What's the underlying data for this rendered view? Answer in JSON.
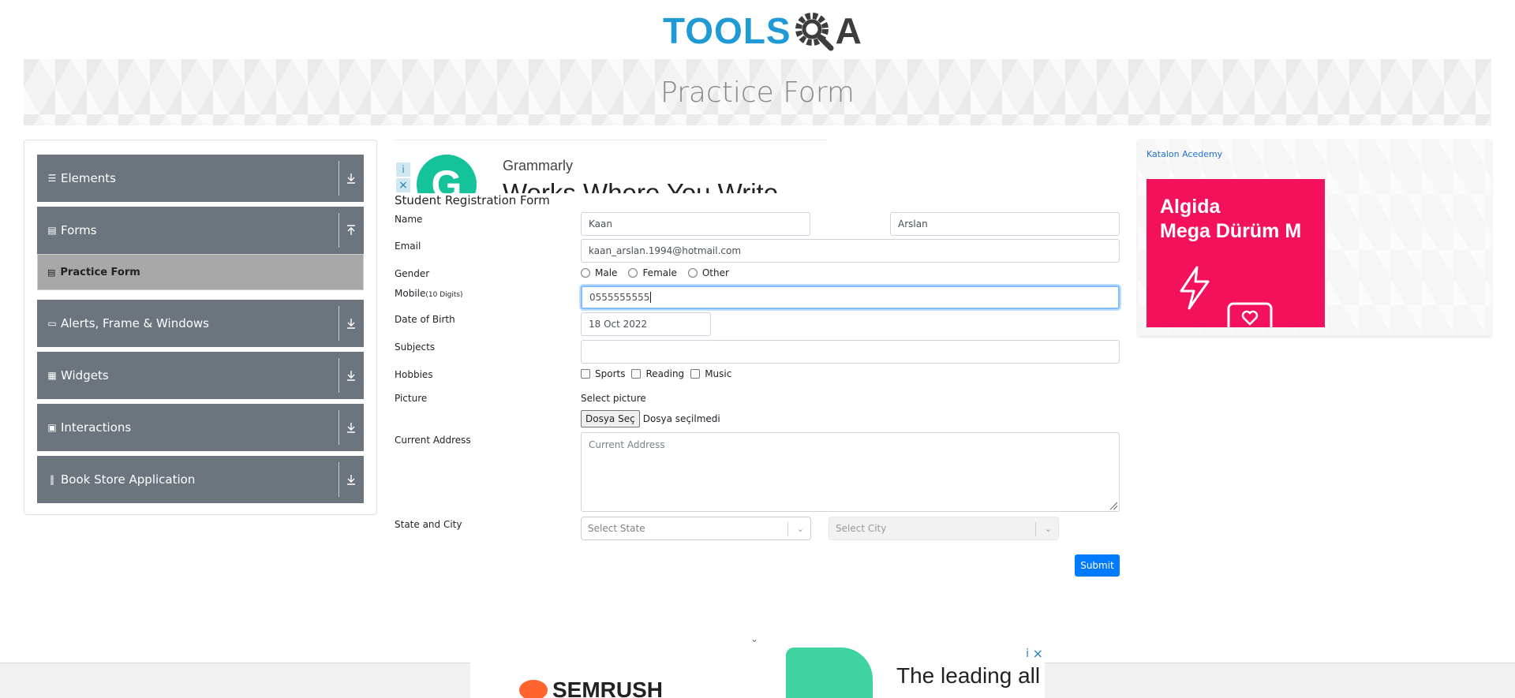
{
  "logo": {
    "part1": "TOOLS",
    "part2": "A"
  },
  "banner": {
    "title": "Practice Form"
  },
  "sidebar": {
    "groups": [
      {
        "label": "Elements",
        "icon": "menu-icon",
        "arrow": "download-arrow-icon"
      },
      {
        "label": "Forms",
        "icon": "document-icon",
        "arrow": "upload-arrow-icon"
      },
      {
        "label": "Alerts, Frame & Windows",
        "icon": "window-icon",
        "arrow": "download-arrow-icon"
      },
      {
        "label": "Widgets",
        "icon": "grid-icon",
        "arrow": "download-arrow-icon"
      },
      {
        "label": "Interactions",
        "icon": "box-icon",
        "arrow": "download-arrow-icon"
      },
      {
        "label": "Book Store Application",
        "icon": "books-icon",
        "arrow": "download-arrow-icon"
      }
    ],
    "active_item": "Practice Form"
  },
  "ad_top": {
    "brand": "Grammarly",
    "slogan": "Works Where You Write",
    "logo_letter": "G",
    "info": "i",
    "close": "×"
  },
  "form": {
    "title": "Student Registration Form",
    "labels": {
      "name": "Name",
      "email": "Email",
      "gender": "Gender",
      "mobile": "Mobile",
      "mobile_hint": "(10 Digits)",
      "dob": "Date of Birth",
      "subjects": "Subjects",
      "hobbies": "Hobbies",
      "picture": "Picture",
      "address": "Current Address",
      "state_city": "State and City"
    },
    "first_name": "Kaan",
    "last_name": "Arslan",
    "email": "kaan_arslan.1994@hotmail.com",
    "gender_options": [
      "Male",
      "Female",
      "Other"
    ],
    "mobile": "0555555555",
    "dob": "18 Oct 2022",
    "subjects": "",
    "hobbies": [
      "Sports",
      "Reading",
      "Music"
    ],
    "picture_label": "Select picture",
    "file_button": "Dosya Seç",
    "file_status": "Dosya seçilmedi",
    "address_placeholder": "Current Address",
    "state_placeholder": "Select State",
    "city_placeholder": "Select City",
    "submit": "Submit"
  },
  "ad_right": {
    "link_text": "Katalon Acedemy",
    "promo_line1": "Algida",
    "promo_line2": "Mega Dürüm M"
  },
  "ad_bottom": {
    "brand": "SEMRUSH",
    "tagline": "The leading all",
    "tagline_bold": "all",
    "info": "i",
    "close": "×"
  },
  "colors": {
    "accent": "#007bff",
    "sidebar_bg": "#6c757d",
    "logo_blue": "#1f9ad6",
    "promo": "#f4115b"
  }
}
